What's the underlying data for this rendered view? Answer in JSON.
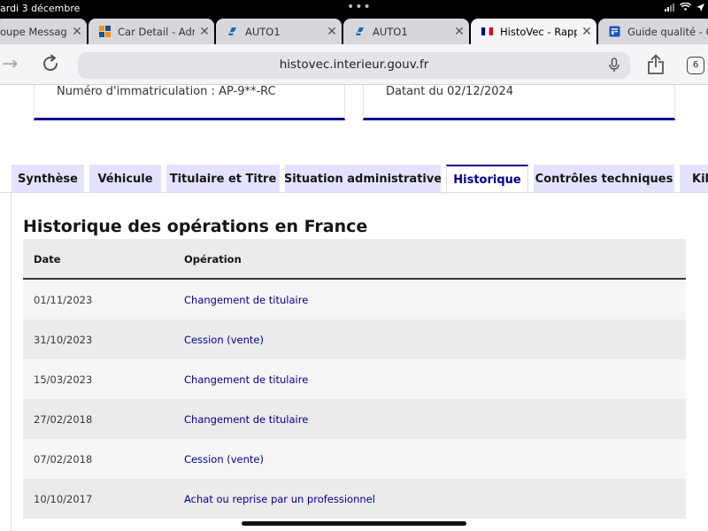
{
  "status_bar": {
    "time": "ardi 3 décembre",
    "dots": "•••"
  },
  "browser_tabs": [
    {
      "label": "oupe Message",
      "icon": "messages-icon"
    },
    {
      "label": "Car Detail - Adm",
      "icon": "grid-logo-icon"
    },
    {
      "label": "AUTO1",
      "icon": "auto1-logo-icon"
    },
    {
      "label": "AUTO1",
      "icon": "auto1-logo-icon"
    },
    {
      "label": "HistoVec - Rapp",
      "icon": "french-flag-icon",
      "active": true
    },
    {
      "label": "Guide qualité - C",
      "icon": "document-icon"
    }
  ],
  "address_bar": {
    "url": "histovec.interieur.gouv.fr",
    "tab_count": "6"
  },
  "cards": {
    "left": "Numéro d'immatriculation : AP-9**-RC",
    "right": "Datant du 02/12/2024"
  },
  "section_tabs": [
    {
      "label": "Synthèse"
    },
    {
      "label": "Véhicule"
    },
    {
      "label": "Titulaire et Titre"
    },
    {
      "label": "Situation administrative"
    },
    {
      "label": "Historique",
      "active": true
    },
    {
      "label": "Contrôles techniques"
    },
    {
      "label": "Kilo"
    }
  ],
  "history": {
    "title": "Historique des opérations en France",
    "columns": {
      "date": "Date",
      "operation": "Opération"
    },
    "rows": [
      {
        "date": "01/11/2023",
        "operation": "Changement de titulaire"
      },
      {
        "date": "31/10/2023",
        "operation": "Cession (vente)"
      },
      {
        "date": "15/03/2023",
        "operation": "Changement de titulaire"
      },
      {
        "date": "27/02/2018",
        "operation": "Changement de titulaire"
      },
      {
        "date": "07/02/2018",
        "operation": "Cession (vente)"
      },
      {
        "date": "10/10/2017",
        "operation": "Achat ou reprise par un professionnel"
      }
    ]
  },
  "colors": {
    "accent": "#000091",
    "tab_inactive": "#e3e3fd",
    "row_alt": "#ebebeb"
  }
}
